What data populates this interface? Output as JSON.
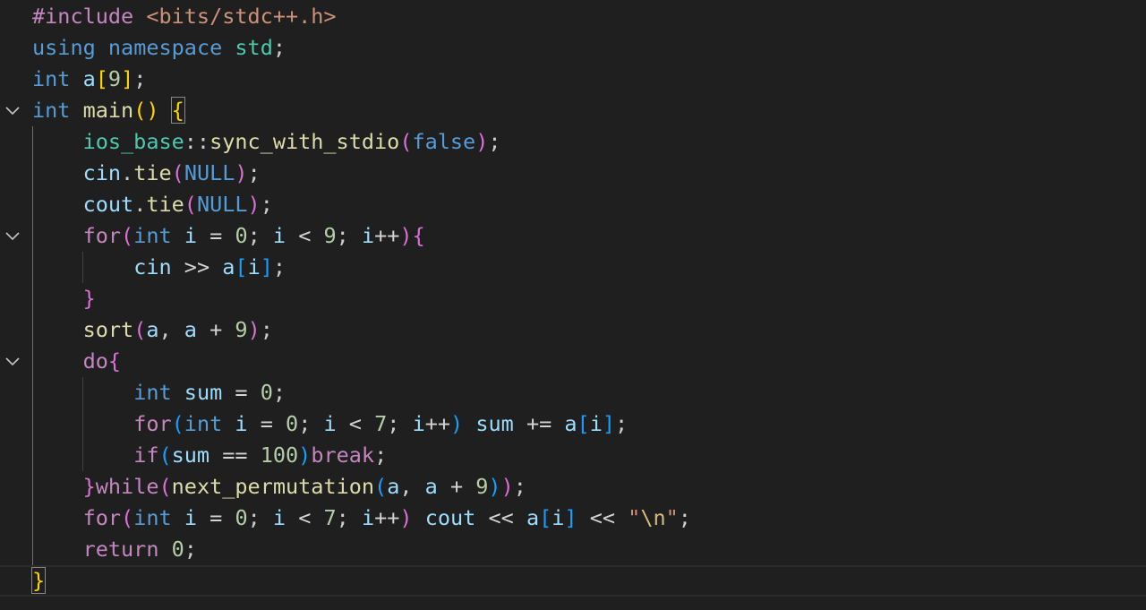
{
  "editor": {
    "language": "cpp",
    "lines": [
      [
        [
          "t-pre",
          "#include"
        ],
        [
          "t-pl",
          " "
        ],
        [
          "t-inc",
          "<bits/stdc++.h>"
        ]
      ],
      [
        [
          "t-kw",
          "using"
        ],
        [
          "t-pl",
          " "
        ],
        [
          "t-kw",
          "namespace"
        ],
        [
          "t-pl",
          " "
        ],
        [
          "t-ns",
          "std"
        ],
        [
          "t-pl",
          ";"
        ]
      ],
      [
        [
          "t-kw",
          "int"
        ],
        [
          "t-pl",
          " "
        ],
        [
          "t-var",
          "a"
        ],
        [
          "t-b1",
          "["
        ],
        [
          "t-num",
          "9"
        ],
        [
          "t-b1",
          "]"
        ],
        [
          "t-pl",
          ";"
        ]
      ],
      [
        [
          "t-kw",
          "int"
        ],
        [
          "t-pl",
          " "
        ],
        [
          "t-fn",
          "main"
        ],
        [
          "t-b1",
          "()"
        ],
        [
          "t-pl",
          " "
        ],
        [
          "t-b1 bracket-match",
          "{"
        ]
      ],
      [
        [
          "t-pl",
          "    "
        ],
        [
          "t-ns",
          "ios_base"
        ],
        [
          "t-pl",
          "::"
        ],
        [
          "t-fn",
          "sync_with_stdio"
        ],
        [
          "t-b2",
          "("
        ],
        [
          "t-kw",
          "false"
        ],
        [
          "t-b2",
          ")"
        ],
        [
          "t-pl",
          ";"
        ]
      ],
      [
        [
          "t-pl",
          "    "
        ],
        [
          "t-var",
          "cin"
        ],
        [
          "t-pl",
          "."
        ],
        [
          "t-fn",
          "tie"
        ],
        [
          "t-b2",
          "("
        ],
        [
          "t-kw",
          "NULL"
        ],
        [
          "t-b2",
          ")"
        ],
        [
          "t-pl",
          ";"
        ]
      ],
      [
        [
          "t-pl",
          "    "
        ],
        [
          "t-var",
          "cout"
        ],
        [
          "t-pl",
          "."
        ],
        [
          "t-fn",
          "tie"
        ],
        [
          "t-b2",
          "("
        ],
        [
          "t-kw",
          "NULL"
        ],
        [
          "t-b2",
          ")"
        ],
        [
          "t-pl",
          ";"
        ]
      ],
      [
        [
          "t-pl",
          "    "
        ],
        [
          "t-ctl",
          "for"
        ],
        [
          "t-b2",
          "("
        ],
        [
          "t-kw",
          "int"
        ],
        [
          "t-pl",
          " "
        ],
        [
          "t-var",
          "i"
        ],
        [
          "t-pl",
          " "
        ],
        [
          "t-op",
          "="
        ],
        [
          "t-pl",
          " "
        ],
        [
          "t-num",
          "0"
        ],
        [
          "t-pl",
          "; "
        ],
        [
          "t-var",
          "i"
        ],
        [
          "t-pl",
          " "
        ],
        [
          "t-op",
          "<"
        ],
        [
          "t-pl",
          " "
        ],
        [
          "t-num",
          "9"
        ],
        [
          "t-pl",
          "; "
        ],
        [
          "t-var",
          "i"
        ],
        [
          "t-op",
          "++"
        ],
        [
          "t-b2",
          ")"
        ],
        [
          "t-b2",
          "{"
        ]
      ],
      [
        [
          "t-pl",
          "        "
        ],
        [
          "t-var",
          "cin"
        ],
        [
          "t-pl",
          " "
        ],
        [
          "t-op",
          ">>"
        ],
        [
          "t-pl",
          " "
        ],
        [
          "t-var",
          "a"
        ],
        [
          "t-b3",
          "["
        ],
        [
          "t-var",
          "i"
        ],
        [
          "t-b3",
          "]"
        ],
        [
          "t-pl",
          ";"
        ]
      ],
      [
        [
          "t-pl",
          "    "
        ],
        [
          "t-b2",
          "}"
        ]
      ],
      [
        [
          "t-pl",
          "    "
        ],
        [
          "t-fn",
          "sort"
        ],
        [
          "t-b2",
          "("
        ],
        [
          "t-var",
          "a"
        ],
        [
          "t-pl",
          ", "
        ],
        [
          "t-var",
          "a"
        ],
        [
          "t-pl",
          " "
        ],
        [
          "t-op",
          "+"
        ],
        [
          "t-pl",
          " "
        ],
        [
          "t-num",
          "9"
        ],
        [
          "t-b2",
          ")"
        ],
        [
          "t-pl",
          ";"
        ]
      ],
      [
        [
          "t-pl",
          "    "
        ],
        [
          "t-ctl",
          "do"
        ],
        [
          "t-b2",
          "{"
        ]
      ],
      [
        [
          "t-pl",
          "        "
        ],
        [
          "t-kw",
          "int"
        ],
        [
          "t-pl",
          " "
        ],
        [
          "t-var",
          "sum"
        ],
        [
          "t-pl",
          " "
        ],
        [
          "t-op",
          "="
        ],
        [
          "t-pl",
          " "
        ],
        [
          "t-num",
          "0"
        ],
        [
          "t-pl",
          ";"
        ]
      ],
      [
        [
          "t-pl",
          "        "
        ],
        [
          "t-ctl",
          "for"
        ],
        [
          "t-b3",
          "("
        ],
        [
          "t-kw",
          "int"
        ],
        [
          "t-pl",
          " "
        ],
        [
          "t-var",
          "i"
        ],
        [
          "t-pl",
          " "
        ],
        [
          "t-op",
          "="
        ],
        [
          "t-pl",
          " "
        ],
        [
          "t-num",
          "0"
        ],
        [
          "t-pl",
          "; "
        ],
        [
          "t-var",
          "i"
        ],
        [
          "t-pl",
          " "
        ],
        [
          "t-op",
          "<"
        ],
        [
          "t-pl",
          " "
        ],
        [
          "t-num",
          "7"
        ],
        [
          "t-pl",
          "; "
        ],
        [
          "t-var",
          "i"
        ],
        [
          "t-op",
          "++"
        ],
        [
          "t-b3",
          ")"
        ],
        [
          "t-pl",
          " "
        ],
        [
          "t-var",
          "sum"
        ],
        [
          "t-pl",
          " "
        ],
        [
          "t-op",
          "+="
        ],
        [
          "t-pl",
          " "
        ],
        [
          "t-var",
          "a"
        ],
        [
          "t-b3",
          "["
        ],
        [
          "t-var",
          "i"
        ],
        [
          "t-b3",
          "]"
        ],
        [
          "t-pl",
          ";"
        ]
      ],
      [
        [
          "t-pl",
          "        "
        ],
        [
          "t-ctl",
          "if"
        ],
        [
          "t-b3",
          "("
        ],
        [
          "t-var",
          "sum"
        ],
        [
          "t-pl",
          " "
        ],
        [
          "t-op",
          "=="
        ],
        [
          "t-pl",
          " "
        ],
        [
          "t-num",
          "100"
        ],
        [
          "t-b3",
          ")"
        ],
        [
          "t-ctl",
          "break"
        ],
        [
          "t-pl",
          ";"
        ]
      ],
      [
        [
          "t-pl",
          "    "
        ],
        [
          "t-b2",
          "}"
        ],
        [
          "t-ctl",
          "while"
        ],
        [
          "t-b2",
          "("
        ],
        [
          "t-fn",
          "next_permutation"
        ],
        [
          "t-b3",
          "("
        ],
        [
          "t-var",
          "a"
        ],
        [
          "t-pl",
          ", "
        ],
        [
          "t-var",
          "a"
        ],
        [
          "t-pl",
          " "
        ],
        [
          "t-op",
          "+"
        ],
        [
          "t-pl",
          " "
        ],
        [
          "t-num",
          "9"
        ],
        [
          "t-b3",
          ")"
        ],
        [
          "t-b2",
          ")"
        ],
        [
          "t-pl",
          ";"
        ]
      ],
      [
        [
          "t-pl",
          "    "
        ],
        [
          "t-ctl",
          "for"
        ],
        [
          "t-b2",
          "("
        ],
        [
          "t-kw",
          "int"
        ],
        [
          "t-pl",
          " "
        ],
        [
          "t-var",
          "i"
        ],
        [
          "t-pl",
          " "
        ],
        [
          "t-op",
          "="
        ],
        [
          "t-pl",
          " "
        ],
        [
          "t-num",
          "0"
        ],
        [
          "t-pl",
          "; "
        ],
        [
          "t-var",
          "i"
        ],
        [
          "t-pl",
          " "
        ],
        [
          "t-op",
          "<"
        ],
        [
          "t-pl",
          " "
        ],
        [
          "t-num",
          "7"
        ],
        [
          "t-pl",
          "; "
        ],
        [
          "t-var",
          "i"
        ],
        [
          "t-op",
          "++"
        ],
        [
          "t-b2",
          ")"
        ],
        [
          "t-pl",
          " "
        ],
        [
          "t-var",
          "cout"
        ],
        [
          "t-pl",
          " "
        ],
        [
          "t-op",
          "<<"
        ],
        [
          "t-pl",
          " "
        ],
        [
          "t-var",
          "a"
        ],
        [
          "t-b3",
          "["
        ],
        [
          "t-var",
          "i"
        ],
        [
          "t-b3",
          "]"
        ],
        [
          "t-pl",
          " "
        ],
        [
          "t-op",
          "<<"
        ],
        [
          "t-pl",
          " "
        ],
        [
          "t-str",
          "\""
        ],
        [
          "t-esc",
          "\\n"
        ],
        [
          "t-str",
          "\""
        ],
        [
          "t-pl",
          ";"
        ]
      ],
      [
        [
          "t-pl",
          "    "
        ],
        [
          "t-ctl",
          "return"
        ],
        [
          "t-pl",
          " "
        ],
        [
          "t-num",
          "0"
        ],
        [
          "t-pl",
          ";"
        ]
      ],
      [
        [
          "t-b1 bracket-match",
          "}"
        ]
      ]
    ],
    "foldable_lines": [
      3,
      7,
      11
    ],
    "current_line": 18
  },
  "icons": {
    "fold": "chevron-down-icon"
  },
  "colors": {
    "background": "#1f1f1f",
    "keyword": "#569cd6",
    "preprocessor": "#c586c0",
    "function": "#dcdcaa",
    "variable": "#9cdcfe",
    "type_namespace": "#4ec9b0",
    "number": "#b5cea8",
    "string": "#ce9178",
    "bracket_level1": "#ffd700",
    "bracket_level2": "#da70d6",
    "bracket_level3": "#179fff"
  }
}
